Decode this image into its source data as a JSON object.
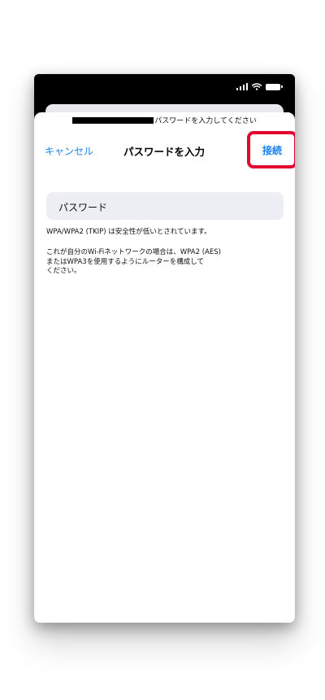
{
  "status_bar": {
    "icons": [
      "signal-icon",
      "wifi-icon",
      "battery-icon"
    ]
  },
  "sheet": {
    "prompt": "パスワードを入力してください"
  },
  "nav": {
    "cancel_label": "キャンセル",
    "title": "パスワードを入力",
    "connect_label": "接続"
  },
  "password_field": {
    "placeholder": "パスワード"
  },
  "notes": {
    "security_warning": "WPA/WPA2 (TKIP) は安全性が低いとされています。",
    "advice_line1": "これが自分のWi-Fiネットワークの場合は、WPA2 (AES)",
    "advice_line2": "またはWPA3を使用するようにルーターを構成して",
    "advice_line3": "ください。"
  },
  "colors": {
    "accent": "#1a82f7",
    "highlight": "#e3072f",
    "field_background": "#ededf4"
  }
}
